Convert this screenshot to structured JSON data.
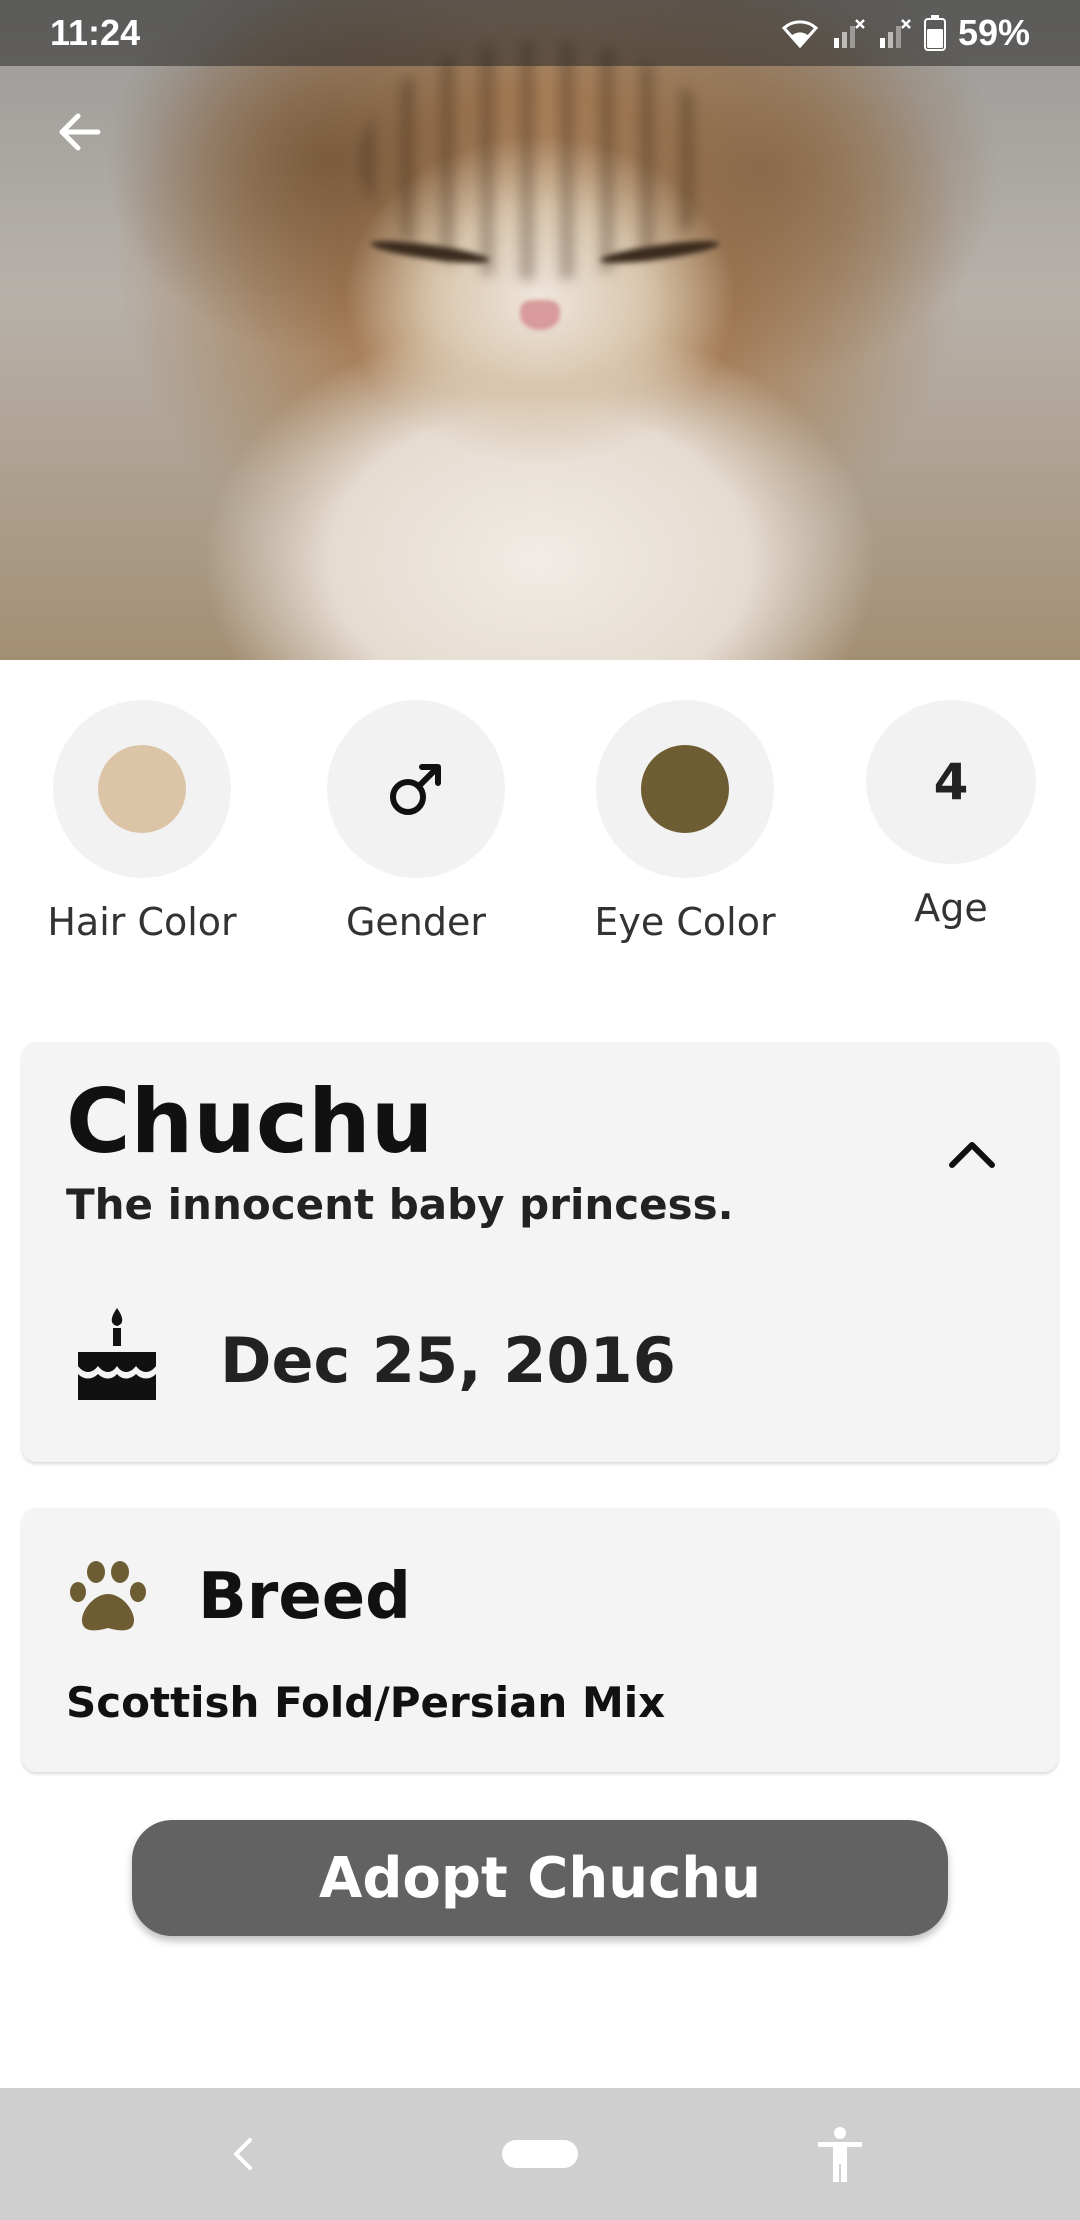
{
  "status_bar": {
    "time": "11:24",
    "battery": "59%"
  },
  "pet": {
    "name": "Chuchu",
    "tagline": "The innocent baby princess.",
    "birthday": "Dec 25, 2016",
    "breed_title": "Breed",
    "breed": "Scottish Fold/Persian Mix",
    "adopt_label": "Adopt Chuchu"
  },
  "attributes": {
    "hair_color": {
      "label": "Hair Color",
      "color": "#dcc4a6"
    },
    "gender": {
      "label": "Gender",
      "icon": "male-symbol-icon"
    },
    "eye_color": {
      "label": "Eye Color",
      "color": "#6e5d32"
    },
    "age": {
      "label": "Age",
      "value": "4"
    }
  },
  "colors": {
    "paw_icon": "#6e5d32",
    "adopt_button": "#626262",
    "card_background": "#f4f4f4"
  }
}
